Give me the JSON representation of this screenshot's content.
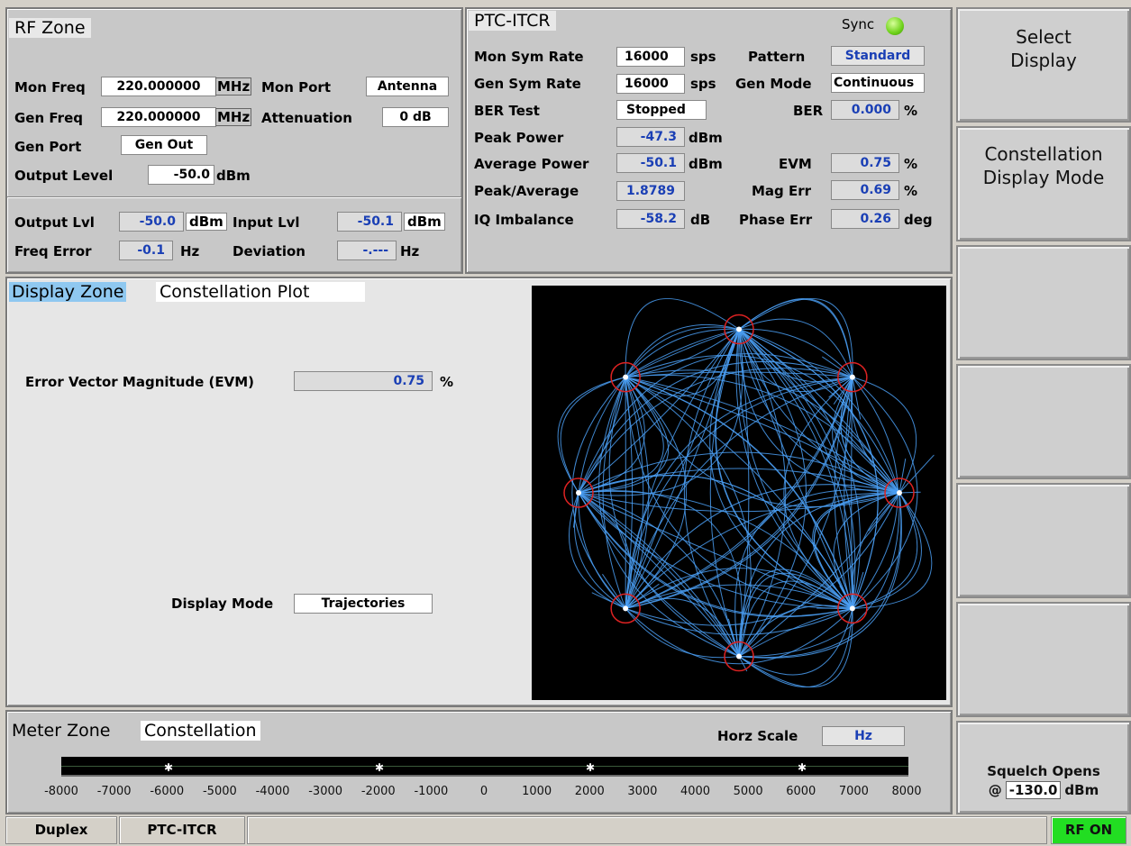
{
  "rf_zone": {
    "title": "RF Zone",
    "mon_freq_label": "Mon Freq",
    "mon_freq_value": "220.000000",
    "mon_freq_unit": "MHz",
    "mon_port_label": "Mon Port",
    "mon_port_value": "Antenna",
    "gen_freq_label": "Gen Freq",
    "gen_freq_value": "220.000000",
    "gen_freq_unit": "MHz",
    "attenuation_label": "Attenuation",
    "attenuation_value": "0 dB",
    "gen_port_label": "Gen Port",
    "gen_port_value": "Gen Out",
    "output_level_label": "Output Level",
    "output_level_value": "-50.0",
    "output_level_unit": "dBm",
    "output_lvl_label": "Output Lvl",
    "output_lvl_value": "-50.0",
    "output_lvl_unit": "dBm",
    "input_lvl_label": "Input Lvl",
    "input_lvl_value": "-50.1",
    "input_lvl_unit": "dBm",
    "freq_error_label": "Freq Error",
    "freq_error_value": "-0.1",
    "freq_error_unit": "Hz",
    "deviation_label": "Deviation",
    "deviation_value": "-.---",
    "deviation_unit": "Hz"
  },
  "ptc": {
    "title": "PTC-ITCR",
    "sync_label": "Sync",
    "mon_sym_rate_label": "Mon Sym Rate",
    "mon_sym_rate_value": "16000",
    "mon_sym_rate_unit": "sps",
    "gen_sym_rate_label": "Gen Sym Rate",
    "gen_sym_rate_value": "16000",
    "gen_sym_rate_unit": "sps",
    "ber_test_label": "BER Test",
    "ber_test_value": "Stopped",
    "peak_power_label": "Peak Power",
    "peak_power_value": "-47.3",
    "peak_power_unit": "dBm",
    "avg_power_label": "Average Power",
    "avg_power_value": "-50.1",
    "avg_power_unit": "dBm",
    "peak_avg_label": "Peak/Average",
    "peak_avg_value": "1.8789",
    "iq_label": "IQ Imbalance",
    "iq_value": "-58.2",
    "iq_unit": "dB",
    "pattern_label": "Pattern",
    "pattern_value": "Standard",
    "gen_mode_label": "Gen Mode",
    "gen_mode_value": "Continuous",
    "ber_label": "BER",
    "ber_value": "0.000",
    "ber_unit": "%",
    "evm_label": "EVM",
    "evm_value": "0.75",
    "evm_unit": "%",
    "mag_err_label": "Mag Err",
    "mag_err_value": "0.69",
    "mag_err_unit": "%",
    "phase_err_label": "Phase Err",
    "phase_err_value": "0.26",
    "phase_err_unit": "deg"
  },
  "display_zone": {
    "title": "Display Zone",
    "plot_title": "Constellation Plot",
    "evm_label": "Error Vector Magnitude (EVM)",
    "evm_value": "0.75",
    "evm_unit": "%",
    "mode_label": "Display Mode",
    "mode_value": "Trajectories"
  },
  "meter_zone": {
    "title": "Meter Zone",
    "meter_title": "Constellation",
    "horz_scale_label": "Horz Scale",
    "horz_scale_value": "Hz",
    "ticks": [
      "-8000",
      "-7000",
      "-6000",
      "-5000",
      "-4000",
      "-3000",
      "-2000",
      "-1000",
      "0",
      "1000",
      "2000",
      "3000",
      "4000",
      "5000",
      "6000",
      "7000",
      "8000"
    ]
  },
  "softkeys": {
    "select_display": "Select Display",
    "constellation_mode": "Constellation Display Mode",
    "squelch_label": "Squelch Opens",
    "squelch_at": "@",
    "squelch_value": "-130.0",
    "squelch_unit": "dBm"
  },
  "status_bar": {
    "duplex": "Duplex",
    "mode": "PTC-ITCR",
    "rf_on": "RF ON"
  }
}
